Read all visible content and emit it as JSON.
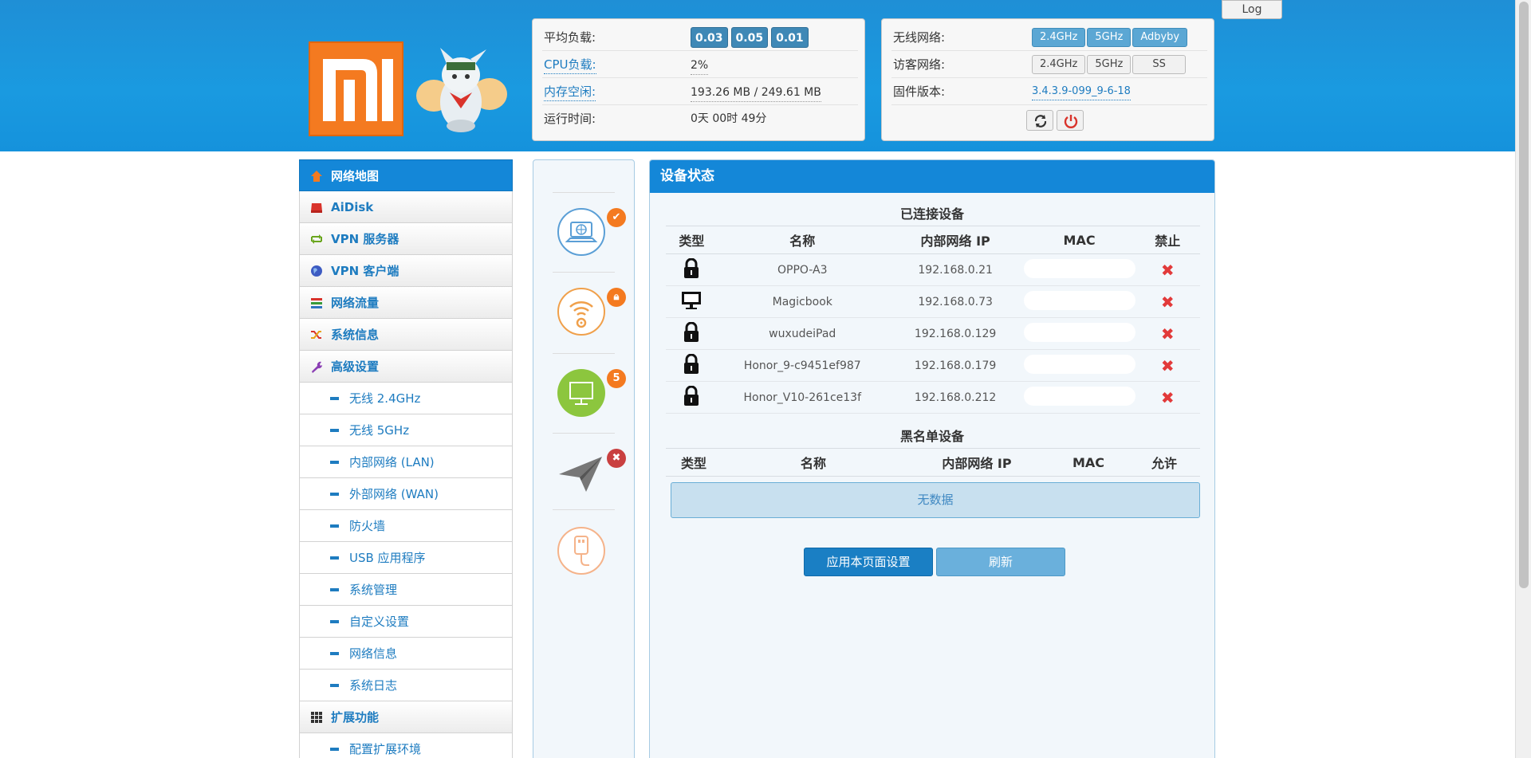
{
  "header": {
    "log_label": "Log"
  },
  "stats": {
    "load_label": "平均负载:",
    "load_values": [
      "0.03",
      "0.05",
      "0.01"
    ],
    "cpu_label": "CPU负载:",
    "cpu_value": "2%",
    "mem_label": "内存空闲:",
    "mem_value": "193.26 MB / 249.61 MB",
    "uptime_label": "运行时间:",
    "uptime_value": "0天 00时 49分"
  },
  "network": {
    "wireless_label": "无线网络:",
    "wireless_buttons": [
      "2.4GHz",
      "5GHz",
      "Adbyby"
    ],
    "guest_label": "访客网络:",
    "guest_buttons": [
      "2.4GHz",
      "5GHz",
      "SS"
    ],
    "firmware_label": "固件版本:",
    "firmware_value": "3.4.3.9-099_9-6-18"
  },
  "menu": {
    "items": [
      {
        "label": "网络地图",
        "icon": "home-icon",
        "active": true
      },
      {
        "label": "AiDisk",
        "icon": "disk-icon"
      },
      {
        "label": "VPN 服务器",
        "icon": "vpn-server-icon"
      },
      {
        "label": "VPN 客户端",
        "icon": "globe-icon"
      },
      {
        "label": "网络流量",
        "icon": "traffic-icon"
      },
      {
        "label": "系统信息",
        "icon": "shuffle-icon"
      },
      {
        "label": "高级设置",
        "icon": "wrench-icon"
      }
    ],
    "sub_items": [
      "无线 2.4GHz",
      "无线 5GHz",
      "内部网络 (LAN)",
      "外部网络 (WAN)",
      "防火墙",
      "USB 应用程序",
      "系统管理",
      "自定义设置",
      "网络信息",
      "系统日志"
    ],
    "ext_label": "扩展功能",
    "ext_sub": "配置扩展环境"
  },
  "status_col": {
    "clients_count": "5"
  },
  "device_panel": {
    "title": "设备状态",
    "connected_title": "已连接设备",
    "blacklist_title": "黑名单设备",
    "columns": [
      "类型",
      "名称",
      "内部网络 IP",
      "MAC",
      "禁止"
    ],
    "blacklist_columns": [
      "类型",
      "名称",
      "内部网络 IP",
      "MAC",
      "允许"
    ],
    "devices": [
      {
        "type": "lock-icon",
        "name": "OPPO-A3",
        "ip": "192.168.0.21"
      },
      {
        "type": "monitor-icon",
        "name": "Magicbook",
        "ip": "192.168.0.73"
      },
      {
        "type": "lock-icon",
        "name": "wuxudeiPad",
        "ip": "192.168.0.129"
      },
      {
        "type": "lock-icon",
        "name": "Honor_9-c9451ef987",
        "ip": "192.168.0.179"
      },
      {
        "type": "lock-icon",
        "name": "Honor_V10-261ce13f",
        "ip": "192.168.0.212"
      }
    ],
    "no_data": "无数据",
    "apply_label": "应用本页面设置",
    "refresh_label": "刷新"
  },
  "colors": {
    "header_blue": "#1a9ae0",
    "menu_active": "#1487d8",
    "logo_orange": "#f47a20",
    "delete_red": "#e23a3a"
  }
}
